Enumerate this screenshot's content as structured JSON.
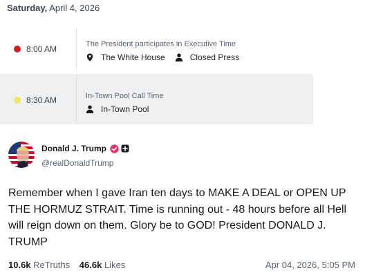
{
  "schedule": {
    "date_day": "Saturday,",
    "date_rest": "April 4, 2026",
    "events": [
      {
        "time": "8:00 AM",
        "dot_color": "#cc2026",
        "title": "The President participates in Executive Time",
        "location": "The White House",
        "access": "Closed Press"
      },
      {
        "time": "8:30 AM",
        "dot_color": "#f2e46a",
        "title": "In-Town Pool Call Time",
        "pool": "In-Town Pool"
      }
    ]
  },
  "post": {
    "author_name": "Donald J. Trump",
    "handle": "@realDonaldTrump",
    "text": "Remember when I gave Iran ten days to MAKE A DEAL or OPEN UP THE HORMUZ STRAIT. Time is running out - 48 hours before all Hell will reign down on them. Glory be to GOD! President DONALD J. TRUMP",
    "retruths_count": "10.6k",
    "retruths_label": "ReTruths",
    "likes_count": "46.6k",
    "likes_label": "Likes",
    "timestamp": "Apr 04, 2026, 5:05 PM",
    "verified_color": "#e8336a"
  }
}
